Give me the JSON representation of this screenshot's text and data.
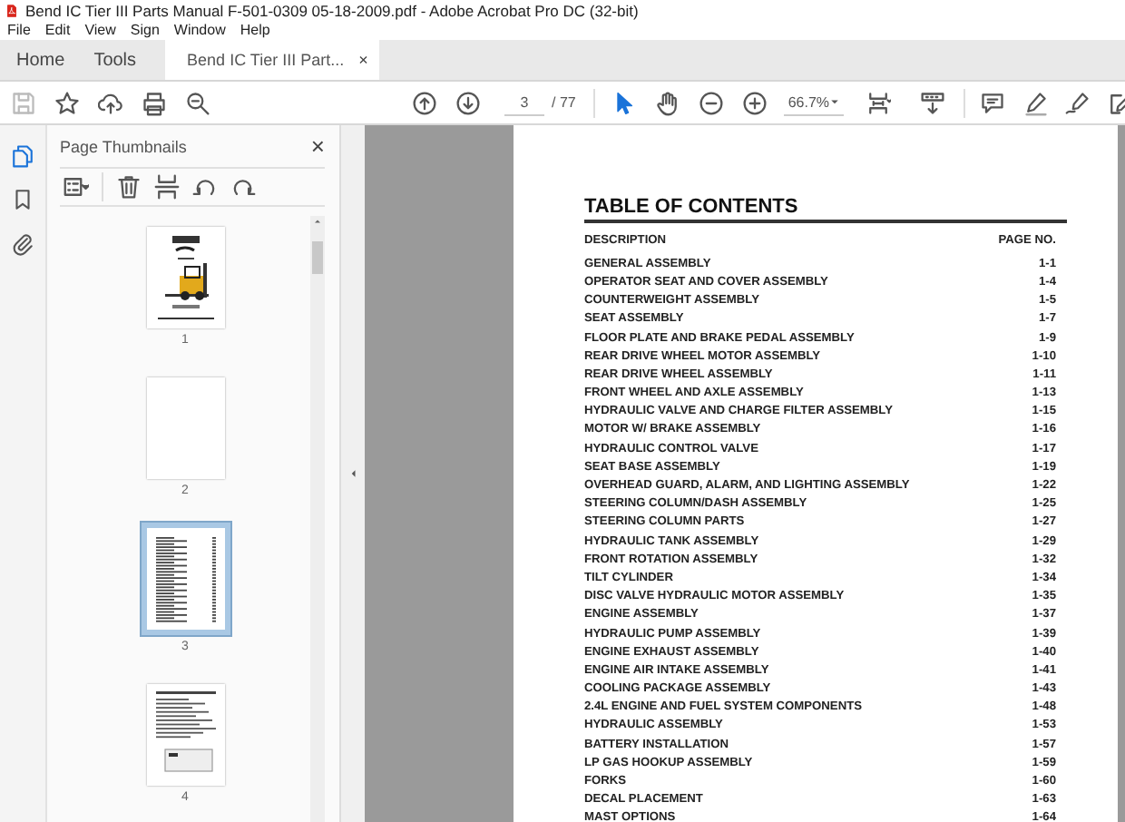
{
  "window": {
    "title": "Bend IC Tier III Parts Manual F-501-0309 05-18-2009.pdf - Adobe Acrobat Pro DC (32-bit)"
  },
  "menu": [
    "File",
    "Edit",
    "View",
    "Sign",
    "Window",
    "Help"
  ],
  "tabs": [
    {
      "label": "Home",
      "selected": false,
      "kind": "nav"
    },
    {
      "label": "Tools",
      "selected": false,
      "kind": "nav"
    },
    {
      "label": "Bend IC Tier III Part...",
      "selected": true,
      "kind": "document",
      "close": "×"
    }
  ],
  "toolbar": {
    "page": "3",
    "page_count": "/ 77",
    "zoom": "66.7%"
  },
  "sidebar": {
    "title": "Page Thumbnails",
    "close": "×",
    "thumbnails": [
      {
        "label": "1",
        "kind": "cover",
        "selected": false
      },
      {
        "label": "2",
        "kind": "blank",
        "selected": false
      },
      {
        "label": "3",
        "kind": "list",
        "selected": true
      },
      {
        "label": "4",
        "kind": "form",
        "selected": false
      }
    ]
  },
  "document": {
    "title": "TABLE OF CONTENTS",
    "columns": [
      "DESCRIPTION",
      "PAGE NO."
    ],
    "rows": [
      [
        "GENERAL ASSEMBLY",
        "1-1"
      ],
      [
        "OPERATOR SEAT AND COVER ASSEMBLY",
        "1-4"
      ],
      [
        "COUNTERWEIGHT ASSEMBLY",
        "1-5"
      ],
      [
        "SEAT ASSEMBLY",
        "1-7"
      ],
      [
        "FLOOR PLATE AND BRAKE PEDAL ASSEMBLY",
        "1-9"
      ],
      [
        "REAR DRIVE WHEEL MOTOR ASSEMBLY",
        "1-10"
      ],
      [
        "REAR DRIVE WHEEL ASSEMBLY",
        "1-11"
      ],
      [
        "FRONT WHEEL AND AXLE ASSEMBLY",
        "1-13"
      ],
      [
        "HYDRAULIC VALVE AND CHARGE FILTER ASSEMBLY",
        "1-15"
      ],
      [
        "MOTOR W/ BRAKE ASSEMBLY",
        "1-16"
      ],
      [
        "HYDRAULIC CONTROL VALVE",
        "1-17"
      ],
      [
        "SEAT BASE ASSEMBLY",
        "1-19"
      ],
      [
        "OVERHEAD GUARD, ALARM, AND LIGHTING ASSEMBLY",
        "1-22"
      ],
      [
        "STEERING COLUMN/DASH ASSEMBLY",
        "1-25"
      ],
      [
        "STEERING COLUMN PARTS",
        "1-27"
      ],
      [
        "HYDRAULIC TANK ASSEMBLY",
        "1-29"
      ],
      [
        "FRONT ROTATION ASSEMBLY",
        "1-32"
      ],
      [
        "TILT CYLINDER",
        "1-34"
      ],
      [
        "DISC VALVE HYDRAULIC MOTOR ASSEMBLY",
        "1-35"
      ],
      [
        "ENGINE ASSEMBLY",
        "1-37"
      ],
      [
        "HYDRAULIC PUMP ASSEMBLY",
        "1-39"
      ],
      [
        "ENGINE EXHAUST ASSEMBLY",
        "1-40"
      ],
      [
        "ENGINE AIR INTAKE ASSEMBLY",
        "1-41"
      ],
      [
        "COOLING PACKAGE ASSEMBLY",
        "1-43"
      ],
      [
        "2.4L ENGINE AND FUEL SYSTEM COMPONENTS",
        "1-48"
      ],
      [
        "HYDRAULIC ASSEMBLY",
        "1-53"
      ],
      [
        "BATTERY INSTALLATION",
        "1-57"
      ],
      [
        "LP GAS HOOKUP ASSEMBLY",
        "1-59"
      ],
      [
        "FORKS",
        "1-60"
      ],
      [
        "DECAL PLACEMENT",
        "1-63"
      ],
      [
        "MAST OPTIONS",
        "1-64"
      ]
    ]
  }
}
